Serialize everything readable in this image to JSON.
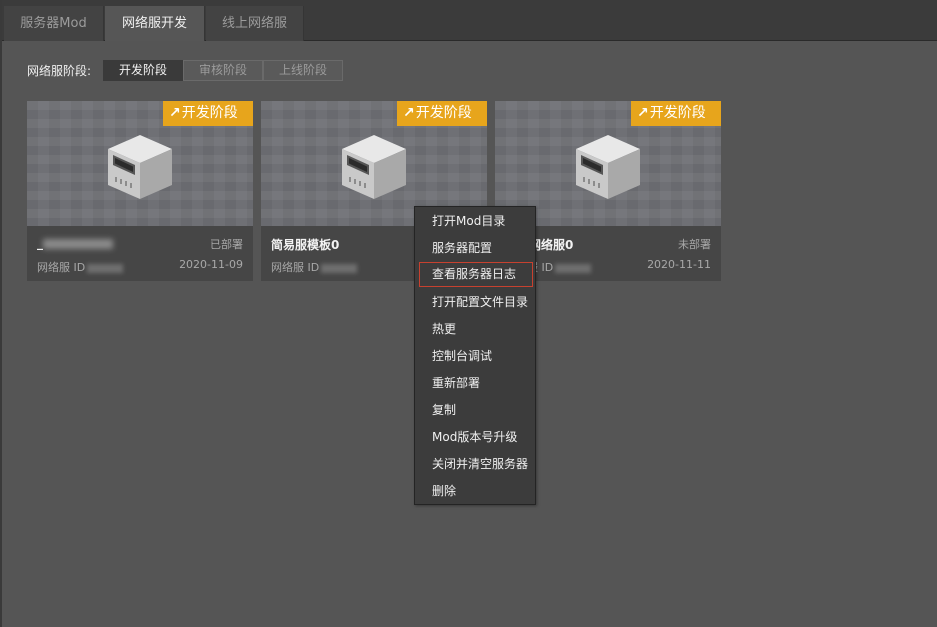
{
  "tabs": [
    {
      "label": "服务器Mod",
      "active": false
    },
    {
      "label": "网络服开发",
      "active": true
    },
    {
      "label": "线上网络服",
      "active": false
    }
  ],
  "stage_filter": {
    "label": "网络服阶段:",
    "options": [
      {
        "label": "开发阶段",
        "active": true
      },
      {
        "label": "审核阶段",
        "active": false
      },
      {
        "label": "上线阶段",
        "active": false
      }
    ]
  },
  "cards": [
    {
      "badge": "开发阶段",
      "name": "_",
      "status": "已部署",
      "id_label": "网络服 ID",
      "date": "2020-11-09"
    },
    {
      "badge": "开发阶段",
      "name": "简易服模板0",
      "status": "",
      "id_label": "网络服 ID",
      "date": ""
    },
    {
      "badge": "开发阶段",
      "name": "简易网络服0",
      "status": "未部署",
      "id_label": "网络服 ID",
      "date": "2020-11-11"
    }
  ],
  "context_menu": {
    "items": [
      {
        "label": "打开Mod目录"
      },
      {
        "label": "服务器配置"
      },
      {
        "label": "查看服务器日志",
        "highlighted": true
      },
      {
        "label": "打开配置文件目录"
      },
      {
        "label": "热更"
      },
      {
        "label": "控制台调试"
      },
      {
        "label": "重新部署"
      },
      {
        "label": "复制"
      },
      {
        "label": "Mod版本号升级"
      },
      {
        "label": "关闭并清空服务器"
      },
      {
        "label": "删除"
      }
    ]
  },
  "colors": {
    "badge": "#e7a51c",
    "highlight_border": "#c7412f",
    "background": "#555555"
  },
  "icons": {
    "badge_arrow": "arrow-up-right-icon",
    "card_thumbnail": "server-icon"
  }
}
